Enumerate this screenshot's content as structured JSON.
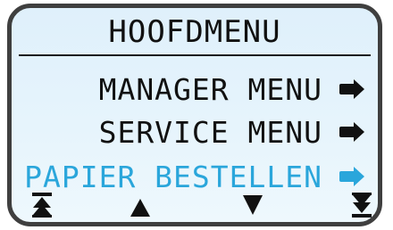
{
  "screen": {
    "title": "HOOFDMENU",
    "menu_items": [
      {
        "label": "MANAGER MENU",
        "icon": "arrow-right-icon",
        "selected": false
      },
      {
        "label": "SERVICE MENU",
        "icon": "arrow-right-icon",
        "selected": false
      },
      {
        "label": "PAPIER BESTELLEN",
        "icon": "arrow-right-icon",
        "selected": true
      }
    ],
    "nav_buttons": [
      {
        "icon": "first-item-icon"
      },
      {
        "icon": "up-arrow-icon"
      },
      {
        "icon": "down-arrow-icon"
      },
      {
        "icon": "last-item-icon"
      }
    ]
  },
  "colors": {
    "screen_bg": "#e2f2fb",
    "text": "#111111",
    "selected": "#2aa6db",
    "bezel": "#3f3f3f"
  }
}
